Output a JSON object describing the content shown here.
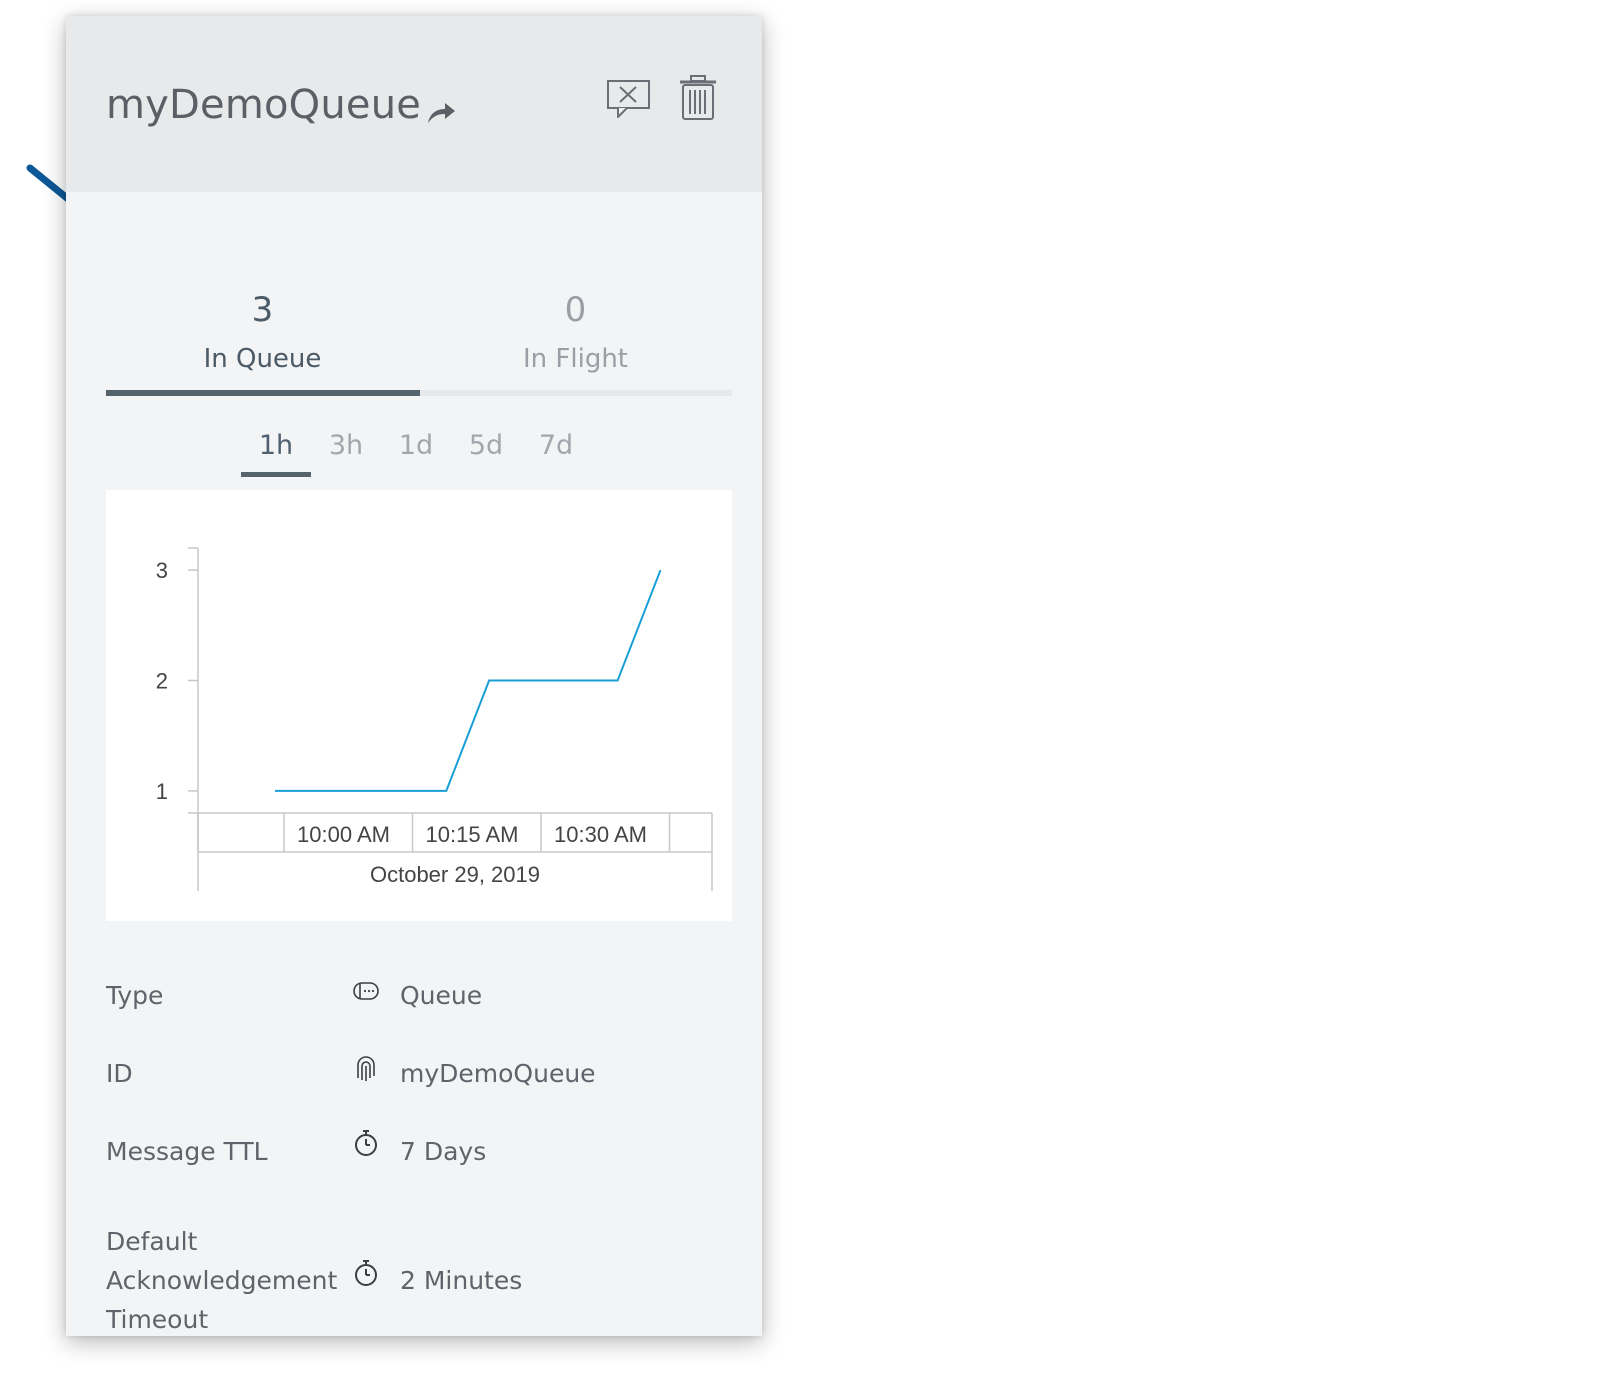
{
  "queue": {
    "name": "myDemoQueue"
  },
  "header": {
    "share_icon": "share-arrow-icon",
    "purge_icon": "purge-messages-icon",
    "delete_icon": "trash-icon"
  },
  "counters": [
    {
      "value": "3",
      "label": "In Queue",
      "active": true
    },
    {
      "value": "0",
      "label": "In Flight",
      "active": false
    }
  ],
  "time_ranges": [
    {
      "label": "1h",
      "active": true
    },
    {
      "label": "3h",
      "active": false
    },
    {
      "label": "1d",
      "active": false
    },
    {
      "label": "5d",
      "active": false
    },
    {
      "label": "7d",
      "active": false
    }
  ],
  "chart_data": {
    "type": "line",
    "title": "",
    "xlabel": "October 29, 2019",
    "ylabel": "",
    "x_ticks": [
      "10:00 AM",
      "10:15 AM",
      "10:30 AM"
    ],
    "y_ticks": [
      1,
      2,
      3
    ],
    "ylim": [
      0.8,
      3.2
    ],
    "series": [
      {
        "color": "#1a9fd6",
        "points": [
          {
            "x": "09:52 AM",
            "y": 1
          },
          {
            "x": "10:12 AM",
            "y": 1
          },
          {
            "x": "10:17 AM",
            "y": 2
          },
          {
            "x": "10:32 AM",
            "y": 2
          },
          {
            "x": "10:37 AM",
            "y": 3
          }
        ]
      }
    ],
    "grid": false,
    "line_color": "#1a9fd6"
  },
  "properties": [
    {
      "label": "Type",
      "icon": "queue-type-icon",
      "value": "Queue"
    },
    {
      "label": "ID",
      "icon": "fingerprint-icon",
      "value": "myDemoQueue"
    },
    {
      "label": "Message TTL",
      "icon": "stopwatch-icon",
      "value": "7 Days"
    },
    {
      "label": "Default Acknowledgement Timeout",
      "icon": "stopwatch-icon",
      "value": "2 Minutes"
    }
  ],
  "annotation": {
    "arrow_color": "#0d5896"
  }
}
